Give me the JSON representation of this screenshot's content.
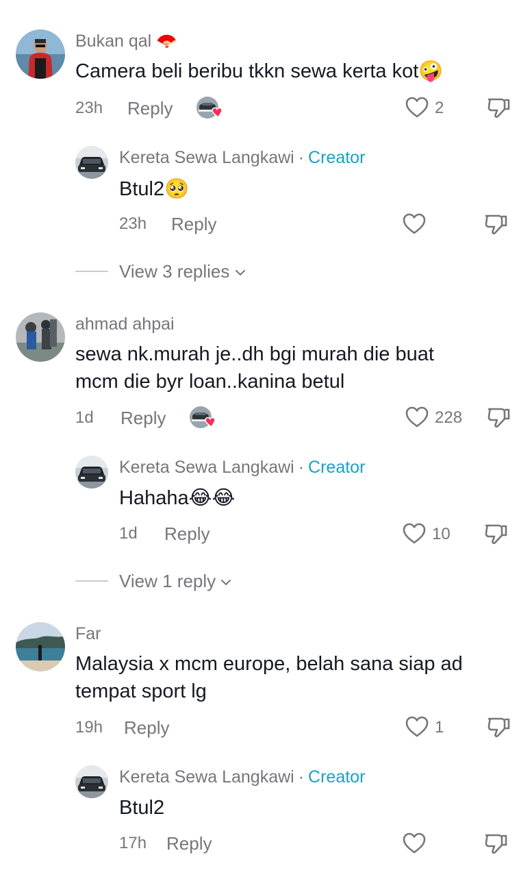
{
  "comments": [
    {
      "username": "Bukan qal",
      "text": "Camera beli beribu tkkn sewa kerta kot🤪",
      "time": "23h",
      "reply_label": "Reply",
      "likes": "2",
      "reply": {
        "username": "Kereta Sewa Langkawi",
        "badge": "Creator",
        "separator": "·",
        "text": "Btul2🥺",
        "time": "23h",
        "reply_label": "Reply",
        "likes": ""
      },
      "view_replies": "View 3 replies"
    },
    {
      "username": "ahmad ahpai",
      "text_line1": "sewa nk.murah je..dh bgi murah die buat",
      "text_line2": "mcm die byr loan..kanina betul",
      "time": "1d",
      "reply_label": "Reply",
      "likes": "228",
      "reply": {
        "username": "Kereta Sewa Langkawi",
        "badge": "Creator",
        "separator": "·",
        "text": "Hahaha😂😂",
        "time": "1d",
        "reply_label": "Reply",
        "likes": "10"
      },
      "view_replies": "View 1 reply"
    },
    {
      "username": "Far",
      "text_line1": "Malaysia x mcm europe, belah sana siap ad",
      "text_line2": "tempat sport lg",
      "time": "19h",
      "reply_label": "Reply",
      "likes": "1",
      "reply": {
        "username": "Kereta Sewa Langkawi",
        "badge": "Creator",
        "separator": "·",
        "text": "Btul2",
        "time": "17h",
        "reply_label": "Reply",
        "likes": ""
      }
    }
  ],
  "icons": {
    "like": "heart-outline-icon",
    "dislike": "thumbs-down-outline-icon",
    "chevron": "chevron-down-icon"
  },
  "colors": {
    "text": "#161823",
    "muted": "#75767c",
    "creator": "#1aa0c6",
    "heart": "#fe2c55"
  }
}
